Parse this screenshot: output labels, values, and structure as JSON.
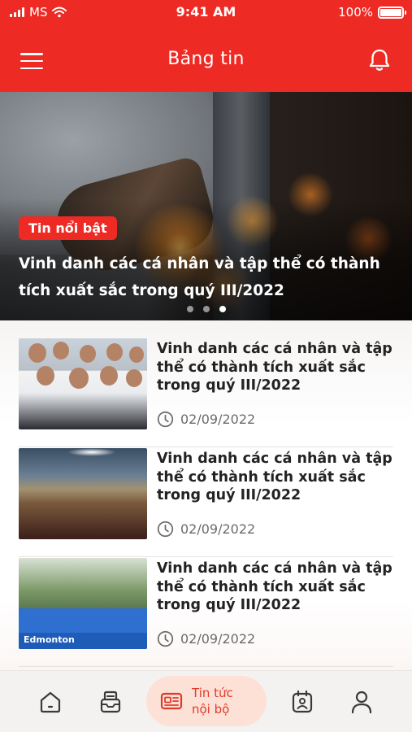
{
  "status": {
    "carrier": "MS",
    "time": "9:41 AM",
    "battery": "100%"
  },
  "header": {
    "title": "Bảng tin",
    "menu_icon": "hamburger-icon",
    "notify_icon": "bell-icon"
  },
  "hero": {
    "badge": "Tin nổi bật",
    "headline": "Vinh danh các cá nhân và tập thể có thành tích xuất sắc trong quý III/2022",
    "slides": 3,
    "active_slide": 2
  },
  "news": [
    {
      "title": "Vinh danh các cá nhân và tập thể có thành tích xuất sắc trong quý III/2022",
      "date": "02/09/2022"
    },
    {
      "title": "Vinh danh các cá nhân và tập thể có thành tích xuất sắc trong quý III/2022",
      "date": "02/09/2022"
    },
    {
      "title": "Vinh danh các cá nhân và tập thể có thành tích xuất sắc trong quý III/2022",
      "date": "02/09/2022",
      "banner_text": "Edmonton"
    }
  ],
  "nav": {
    "items": [
      {
        "icon": "home-icon"
      },
      {
        "icon": "inbox-icon"
      },
      {
        "icon": "newspaper-icon",
        "label_line1": "Tin tức",
        "label_line2": "nội bộ",
        "active": true
      },
      {
        "icon": "calendar-badge-icon"
      },
      {
        "icon": "user-icon"
      }
    ]
  },
  "colors": {
    "brand": "#ee2a24",
    "active_pill": "#fde1d6",
    "active_text": "#e03a2a"
  }
}
